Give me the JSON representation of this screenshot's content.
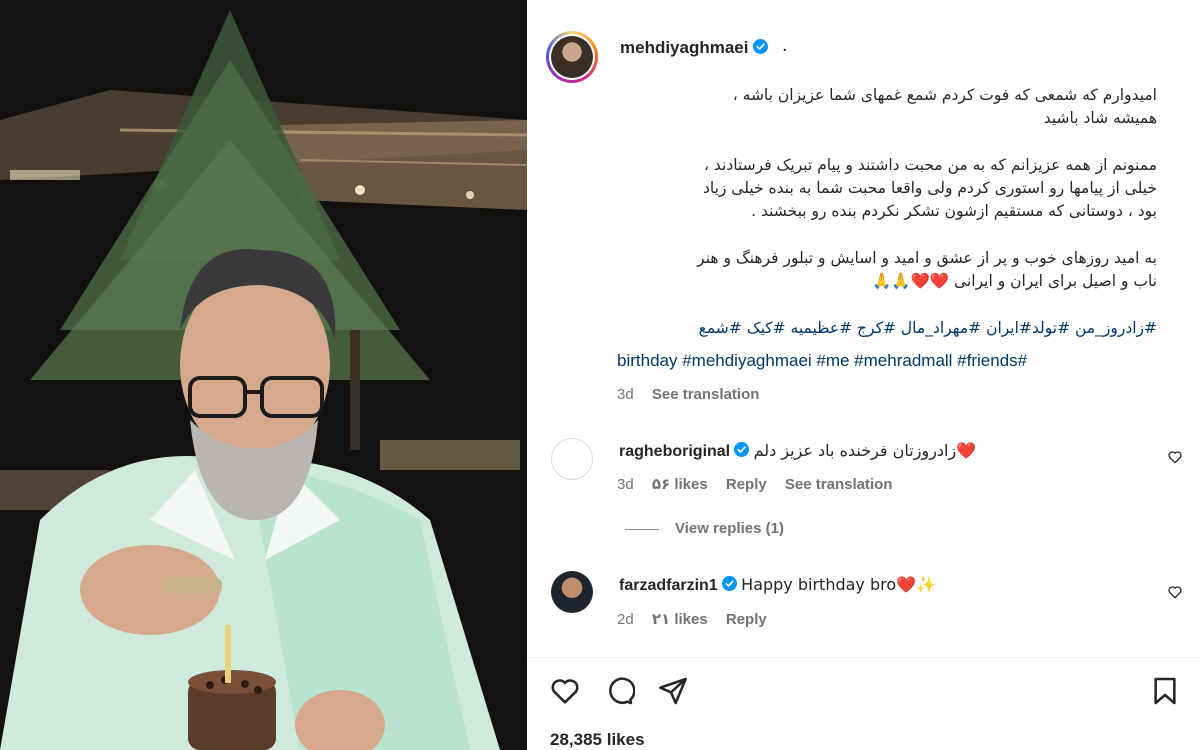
{
  "post": {
    "username": "mehdiyaghmaei",
    "header_dot": ".",
    "caption_paragraphs": [
      [
        "امیدوارم که شمعی که فوت کردم شمع غمهای شما عزیزان باشه ،",
        "همیشه شاد باشید"
      ],
      [
        "ممنونم از همه عزیزانم که به من محبت داشتند و پیام تبریک فرستادند ،",
        "خیلی از پیامها رو استوری کردم ولی واقعا محبت شما به بنده خیلی زیاد",
        "بود ، دوستانی که مستقیم ازشون تشکر نکردم بنده رو ببخشند ."
      ],
      [
        "به امید روزهای خوب و پر از عشق و امید و اسایش و تبلور فرهنگ و هنر",
        "ناب و اصیل برای ایران و ایرانی ❤️❤️🙏🙏"
      ]
    ],
    "hashtags_fa": "#زادروز_من #تولد#ایران #مهراد_مال #کرج #عظیمیه #کیک #شمع",
    "hashtags_en": "birthday #mehdiyaghmaei #me #mehradmall #friends#",
    "time": "3d",
    "see_translation": "See translation"
  },
  "comments": [
    {
      "username": "ragheboriginal",
      "text": "زادروزتان فرخنده باد عزیز دلم❤️",
      "time": "3d",
      "likes": "۵۶ likes",
      "reply": "Reply",
      "see_translation": "See translation",
      "view_replies": "View replies (1)"
    },
    {
      "username": "farzadfarzin1",
      "text": "Happy birthday bro❤️✨",
      "time": "2d",
      "likes": "۲۱ likes",
      "reply": "Reply"
    }
  ],
  "actions": {
    "like_icon": "heart-icon",
    "comment_icon": "comment-icon",
    "share_icon": "send-icon",
    "save_icon": "bookmark-icon"
  },
  "likes_count": "28,385 likes",
  "colors": {
    "text": "#262626",
    "secondary": "#737373",
    "hashtag": "#00376b",
    "verified": "#0095f6",
    "heart": "#e0245e"
  }
}
